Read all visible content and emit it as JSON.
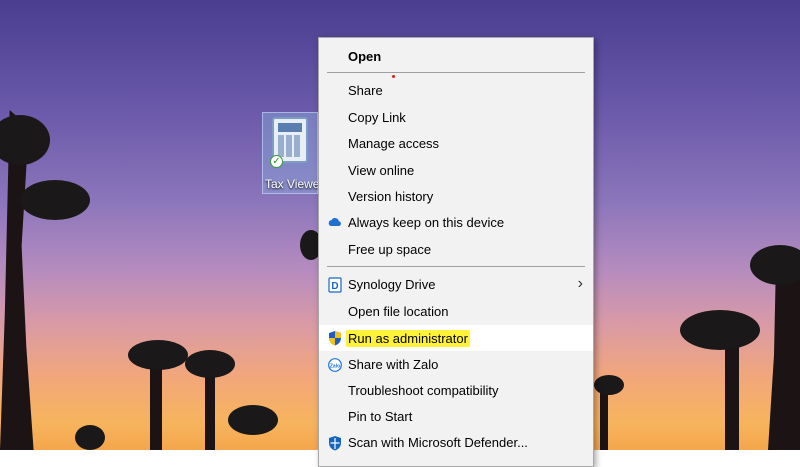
{
  "desktop": {
    "icon_label": "Tax Viewer"
  },
  "menu": {
    "items": [
      {
        "label": "Open"
      },
      {
        "label": "Share"
      },
      {
        "label": "Copy Link"
      },
      {
        "label": "Manage access"
      },
      {
        "label": "View online"
      },
      {
        "label": "Version history"
      },
      {
        "label": "Always keep on this device",
        "icon": "cloud-icon"
      },
      {
        "label": "Free up space"
      },
      {
        "label": "Synology Drive",
        "icon": "synology-drive-icon",
        "submenu": true
      },
      {
        "label": "Open file location"
      },
      {
        "label": "Run as administrator",
        "icon": "uac-shield-icon",
        "highlighted": true
      },
      {
        "label": "Share with Zalo",
        "icon": "zalo-icon"
      },
      {
        "label": "Troubleshoot compatibility"
      },
      {
        "label": "Pin to Start"
      },
      {
        "label": "Scan with Microsoft Defender...",
        "icon": "defender-icon"
      }
    ],
    "chevron": "›"
  },
  "colors": {
    "highlight": "#fff23a",
    "menu_bg": "#f2f2f2",
    "onedrive": "#1f6fd1"
  }
}
